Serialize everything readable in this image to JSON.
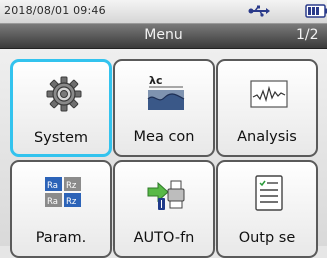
{
  "status": {
    "datetime": "2018/08/01 09:46",
    "usb_icon": "usb-icon",
    "battery_icon": "battery-icon"
  },
  "header": {
    "title": "Menu",
    "page": "1/2"
  },
  "colors": {
    "selection": "#33c3ee",
    "titlebar": "#4a4a4a"
  },
  "menu": {
    "items": [
      {
        "label": "System",
        "icon": "gear-icon",
        "selected": true
      },
      {
        "label": "Mea con",
        "icon": "measurement-condition-icon",
        "selected": false
      },
      {
        "label": "Analysis",
        "icon": "waveform-icon",
        "selected": false
      },
      {
        "label": "Param.",
        "icon": "parameters-icon",
        "selected": false
      },
      {
        "label": "AUTO-fn",
        "icon": "auto-print-icon",
        "selected": false
      },
      {
        "label": "Outp se",
        "icon": "output-settings-icon",
        "selected": false
      }
    ]
  }
}
